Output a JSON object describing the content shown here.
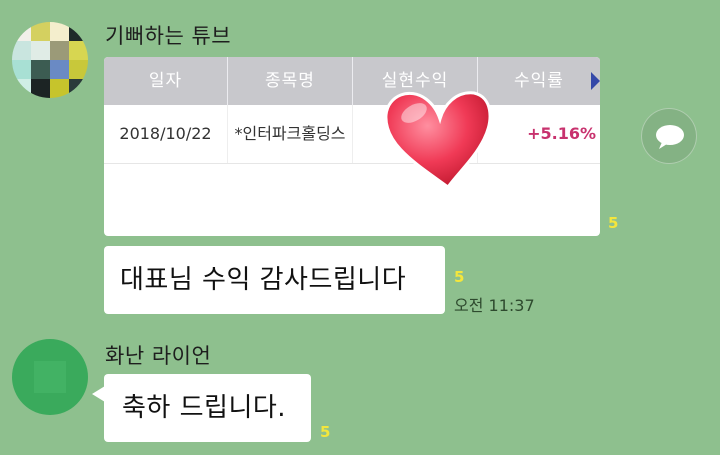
{
  "chat": {
    "messages": [
      {
        "sender": "기뻐하는 튜브",
        "card": {
          "columns": [
            "일자",
            "종목명",
            "실현수익",
            "수익률"
          ],
          "row": [
            "2018/10/22",
            "*인터파크홀딩스",
            "",
            "+5.16%"
          ]
        },
        "card_unread": "5",
        "text": "대표님 수익 감사드립니다",
        "text_unread": "5",
        "time": "오전 11:37"
      },
      {
        "sender": "화난 라이언",
        "text": "축하 드립니다.",
        "text_unread": "5"
      }
    ]
  },
  "icons": {
    "share": "speech-bubble-icon",
    "more": "arrow-right-icon",
    "sticker": "heart-sticker-icon"
  },
  "colors": {
    "background": "#8ec08e",
    "unread": "#f4e63c",
    "profit": "#c8326e",
    "table_header": "#c8c8cc"
  }
}
